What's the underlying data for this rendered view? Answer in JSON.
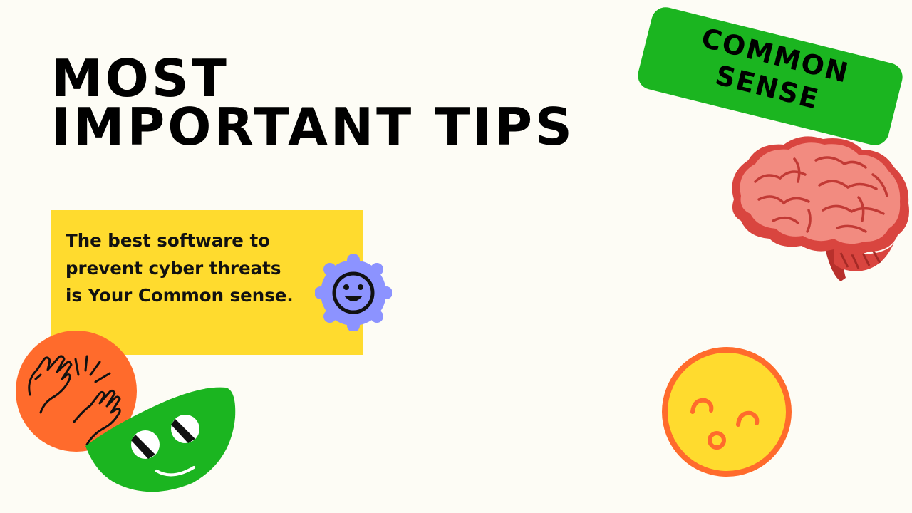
{
  "title": {
    "line1": "MOST",
    "line2": "IMPORTANT TIPS"
  },
  "tip": {
    "text": "The best software to prevent cyber threats is Your Common sense."
  },
  "badge": {
    "line1": "COMMON",
    "line2": "SENSE"
  },
  "colors": {
    "background": "#fdfcf5",
    "yellow": "#ffdb2e",
    "green": "#1bb520",
    "orange": "#ff6b2c",
    "periwinkle": "#8c93ff",
    "brain_pink": "#f0827a",
    "brain_dark": "#d9453f"
  },
  "icons": {
    "hands": "hands-high-five-icon",
    "smiley_badge": "smiley-face-icon",
    "green_face": "green-melon-face-icon",
    "brain": "brain-icon",
    "yellow_face": "kissing-face-icon"
  }
}
